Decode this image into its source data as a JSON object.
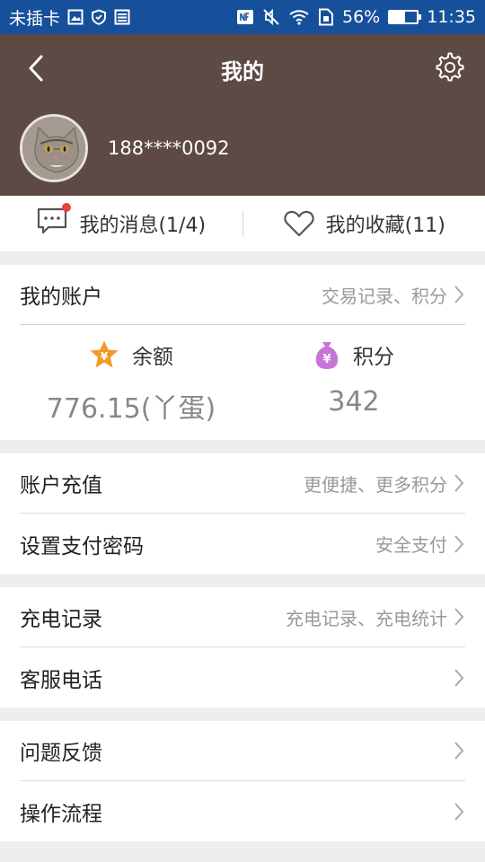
{
  "status_bar": {
    "carrier": "未插卡",
    "battery_percent": "56%",
    "battery_level": 0.56,
    "time": "11:35"
  },
  "header": {
    "title": "我的",
    "phone": "188****0092"
  },
  "quick_links": {
    "messages": "我的消息(1/4)",
    "favorites": "我的收藏(11)"
  },
  "account": {
    "title": "我的账户",
    "hint": "交易记录、积分",
    "balance_label": "余额",
    "balance_value": "776.15(丫蛋)",
    "points_label": "积分",
    "points_value": "342"
  },
  "menu_group1": [
    {
      "label": "账户充值",
      "hint": "更便捷、更多积分"
    },
    {
      "label": "设置支付密码",
      "hint": "安全支付"
    }
  ],
  "menu_group2": [
    {
      "label": "充电记录",
      "hint": "充电记录、充电统计"
    },
    {
      "label": "客服电话",
      "hint": ""
    }
  ],
  "menu_group3": [
    {
      "label": "问题反馈",
      "hint": ""
    },
    {
      "label": "操作流程",
      "hint": ""
    }
  ],
  "colors": {
    "status_bar": "#17509a",
    "header": "#5d4a45",
    "balance_icon": "#f39a22",
    "points_icon": "#c776d8",
    "notification_dot": "#e8423a"
  }
}
